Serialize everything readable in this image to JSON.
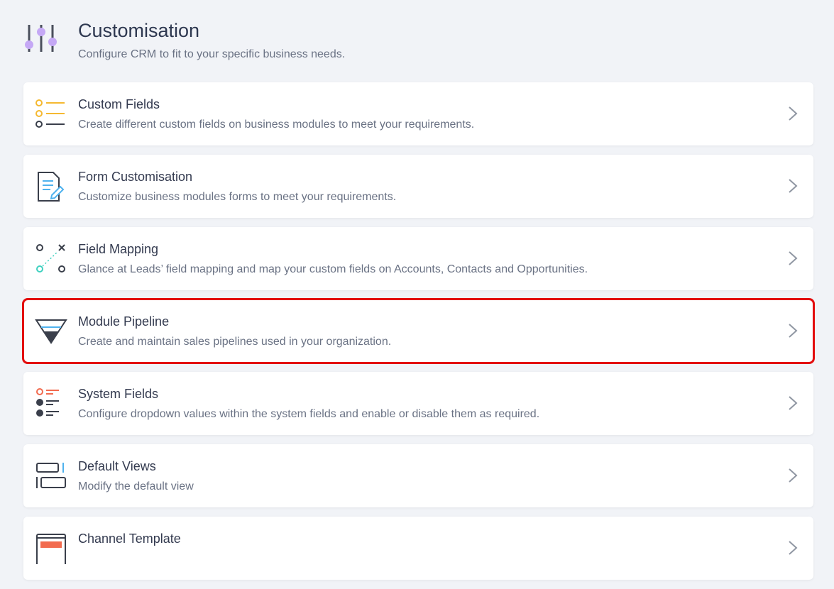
{
  "header": {
    "title": "Customisation",
    "subtitle": "Configure CRM to fit to your specific business needs.",
    "icon": "sliders-icon",
    "accent": "#c5a8f5"
  },
  "items": [
    {
      "title": "Custom Fields",
      "description": "Create different custom fields on business modules to meet your requirements.",
      "icon": "custom-fields-icon"
    },
    {
      "title": "Form Customisation",
      "description": "Customize business modules forms to meet your requirements.",
      "icon": "form-edit-icon"
    },
    {
      "title": "Field Mapping",
      "description": "Glance at Leads’ field mapping and map your custom fields on Accounts, Contacts and Opportunities.",
      "icon": "field-mapping-icon"
    },
    {
      "title": "Module Pipeline",
      "description": "Create and maintain sales pipelines used in your organization.",
      "icon": "funnel-icon",
      "selected": true
    },
    {
      "title": "System Fields",
      "description": "Configure dropdown values within the system fields and enable or disable them as required.",
      "icon": "system-fields-icon"
    },
    {
      "title": "Default Views",
      "description": "Modify the default view",
      "icon": "default-views-icon"
    },
    {
      "title": "Channel Template",
      "description": "",
      "icon": "channel-template-icon"
    }
  ],
  "colors": {
    "highlight": "#e30d0d",
    "yellow": "#f5b931",
    "orange": "#f26b4f",
    "teal": "#3fd1c0",
    "blue": "#4fb2ee",
    "dark": "#3a3f4b"
  }
}
